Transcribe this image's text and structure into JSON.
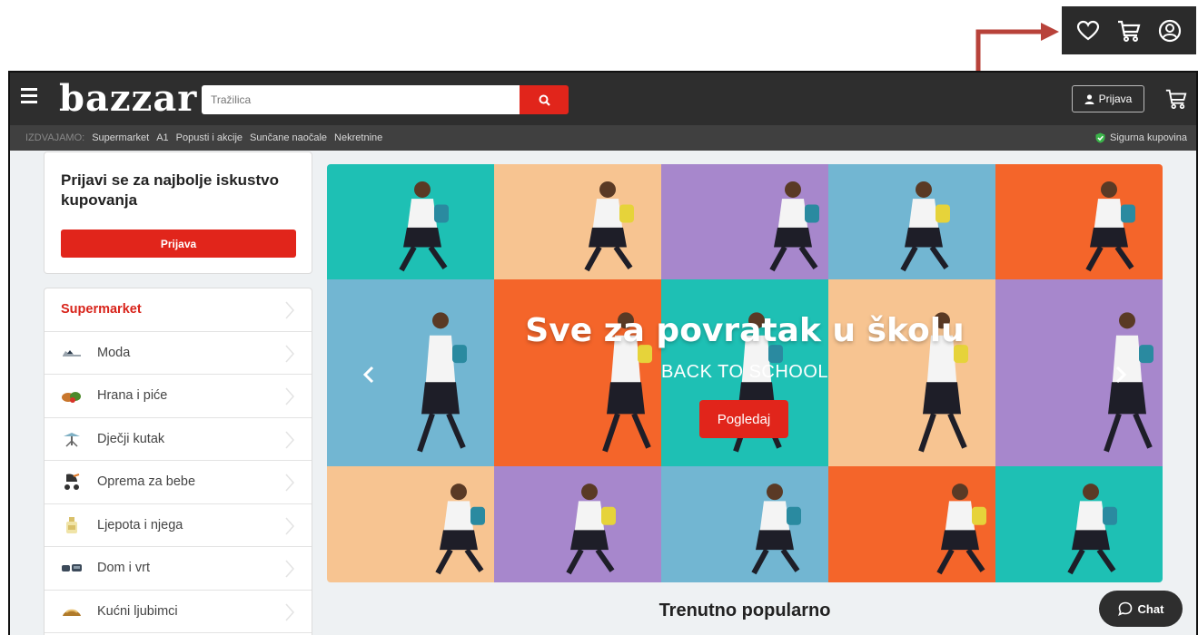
{
  "callout": {
    "icons": [
      "heart-icon",
      "cart-icon",
      "user-circle-icon"
    ],
    "arrow_color": "#b8423a"
  },
  "header": {
    "logo": "bazzar",
    "search_placeholder": "Tražilica",
    "login_label": "Prijava"
  },
  "subnav": {
    "label": "IZDVAJAMO:",
    "links": [
      "Supermarket",
      "A1",
      "Popusti i akcije",
      "Sunčane naočale",
      "Nekretnine"
    ],
    "secure_label": "Sigurna kupovina"
  },
  "login_card": {
    "title": "Prijavi se za najbolje iskustvo kupovanja",
    "button": "Prijava"
  },
  "categories": [
    {
      "label": "Supermarket",
      "icon": ""
    },
    {
      "label": "Moda",
      "icon": "shoes-icon"
    },
    {
      "label": "Hrana i piće",
      "icon": "food-icon"
    },
    {
      "label": "Dječji kutak",
      "icon": "toy-icon"
    },
    {
      "label": "Oprema za bebe",
      "icon": "stroller-icon"
    },
    {
      "label": "Ljepota i njega",
      "icon": "cosmetics-icon"
    },
    {
      "label": "Dom i vrt",
      "icon": "furniture-icon"
    },
    {
      "label": "Kućni ljubimci",
      "icon": "pet-icon"
    }
  ],
  "hero": {
    "title": "Sve za povratak u školu",
    "subtitle": "BACK TO SCHOOL",
    "button": "Pogledaj"
  },
  "popular_title": "Trenutno popularno",
  "chat_label": "Chat",
  "colors": {
    "brand_red": "#e1251b",
    "header_dark": "#2e2e2e",
    "tile_teal": "#1ec0b4",
    "tile_peach": "#f7c491",
    "tile_purple": "#a787cc",
    "tile_blue": "#72b6d2",
    "tile_orange": "#f4652a"
  }
}
